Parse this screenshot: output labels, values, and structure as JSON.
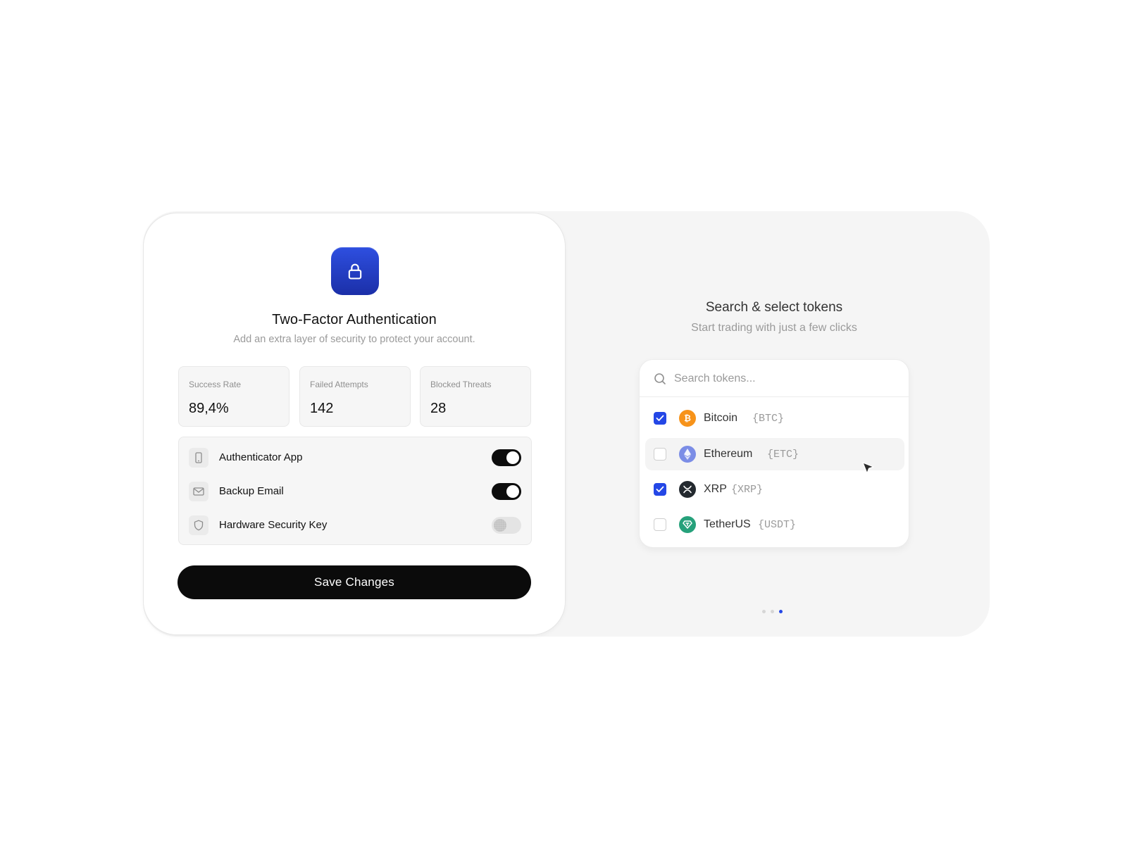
{
  "security": {
    "title": "Two-Factor Authentication",
    "subtitle": "Add an extra layer of security to protect your account.",
    "icon": "lock-icon",
    "accent_color": "#1f38c4",
    "stats": [
      {
        "label": "Success Rate",
        "value": "89,4%"
      },
      {
        "label": "Failed Attempts",
        "value": "142"
      },
      {
        "label": "Blocked Threats",
        "value": "28"
      }
    ],
    "methods": [
      {
        "label": "Authenticator App",
        "icon": "smartphone-icon",
        "enabled": true
      },
      {
        "label": "Backup Email",
        "icon": "mail-icon",
        "enabled": true
      },
      {
        "label": "Hardware Security Key",
        "icon": "shield-icon",
        "enabled": false
      }
    ],
    "save_label": "Save Changes"
  },
  "tokens": {
    "title": "Search & select tokens",
    "subtitle": "Start trading with just a few clicks",
    "search_placeholder": "Search tokens...",
    "items": [
      {
        "name": "Bitcoin",
        "symbol": "{BTC}",
        "checked": true,
        "icon": "bitcoin-icon",
        "color": "#f7931a"
      },
      {
        "name": "Ethereum",
        "symbol": "{ETC}",
        "checked": false,
        "icon": "ethereum-icon",
        "color": "#7b8de6",
        "hovered": true
      },
      {
        "name": "XRP",
        "symbol": "{XRP}",
        "checked": true,
        "icon": "xrp-icon",
        "color": "#23292f"
      },
      {
        "name": "TetherUS",
        "symbol": "{USDT}",
        "checked": false,
        "icon": "tether-icon",
        "color": "#26a17b"
      }
    ],
    "checkbox_color": "#2447e6"
  },
  "pagination": {
    "total": 3,
    "active_index": 2
  }
}
